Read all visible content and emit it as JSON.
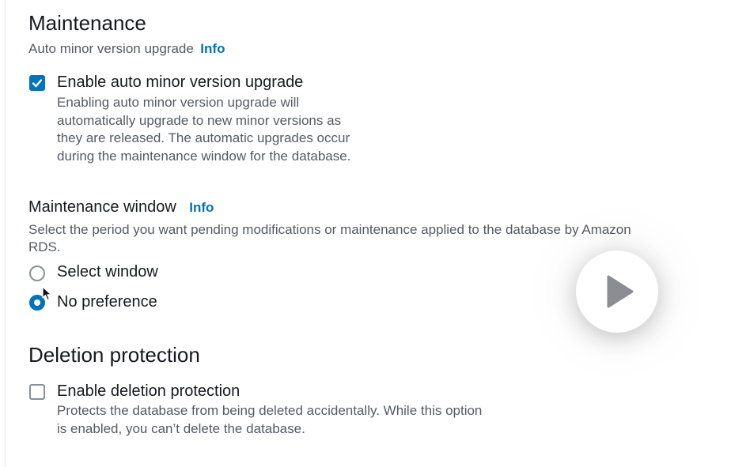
{
  "maintenance": {
    "title": "Maintenance",
    "subtitle": "Auto minor version upgrade",
    "info": "Info",
    "auto_upgrade": {
      "label": "Enable auto minor version upgrade",
      "checked": true,
      "desc_lines": [
        "Enabling auto minor version upgrade will",
        "automatically upgrade to new minor versions as",
        "they are released. The automatic upgrades occur",
        "during the maintenance window for the database."
      ]
    }
  },
  "window": {
    "title": "Maintenance window",
    "info": "Info",
    "desc_lines": [
      "Select the period you want pending modifications or maintenance applied to the database by Amazon",
      "RDS."
    ],
    "options": [
      {
        "label": "Select window",
        "selected": false
      },
      {
        "label": "No preference",
        "selected": true
      }
    ]
  },
  "deletion": {
    "title": "Deletion protection",
    "checkbox": {
      "label": "Enable deletion protection",
      "checked": false,
      "desc_lines": [
        "Protects the database from being deleted accidentally. While this option",
        "is enabled, you can’t delete the database."
      ]
    }
  },
  "icons": {
    "checkmark": "check-icon",
    "play": "play-icon",
    "cursor": "mouse-pointer-icon"
  },
  "colors": {
    "accent": "#0073bb",
    "text": "#16191f",
    "secondary": "#545b64",
    "border": "#879196"
  }
}
